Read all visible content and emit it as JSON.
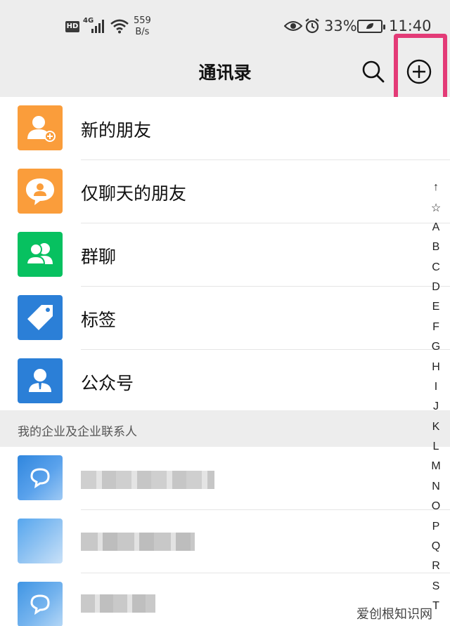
{
  "status_bar": {
    "hd": "HD",
    "network": "4G",
    "speed_value": "559",
    "speed_unit": "B/s",
    "battery_percent": "33%",
    "time": "11:40"
  },
  "header": {
    "title": "通讯录",
    "search_icon": "search-icon",
    "add_icon": "plus-circle-icon",
    "highlight_color": "#e33b77"
  },
  "menu": [
    {
      "label": "新的朋友",
      "icon": "add-friend-icon",
      "color": "#fa9d3b"
    },
    {
      "label": "仅聊天的朋友",
      "icon": "chat-friend-icon",
      "color": "#fa9d3b"
    },
    {
      "label": "群聊",
      "icon": "group-icon",
      "color": "#07c160"
    },
    {
      "label": "标签",
      "icon": "tag-icon",
      "color": "#2b7fd7"
    },
    {
      "label": "公众号",
      "icon": "official-account-icon",
      "color": "#2b7fd7"
    }
  ],
  "section": {
    "enterprise_header": "我的企业及企业联系人"
  },
  "index_bar": [
    "↑",
    "☆",
    "A",
    "B",
    "C",
    "D",
    "E",
    "F",
    "G",
    "H",
    "I",
    "J",
    "K",
    "L",
    "M",
    "N",
    "O",
    "P",
    "Q",
    "R",
    "S",
    "T"
  ],
  "watermark": "爱创根知识网"
}
